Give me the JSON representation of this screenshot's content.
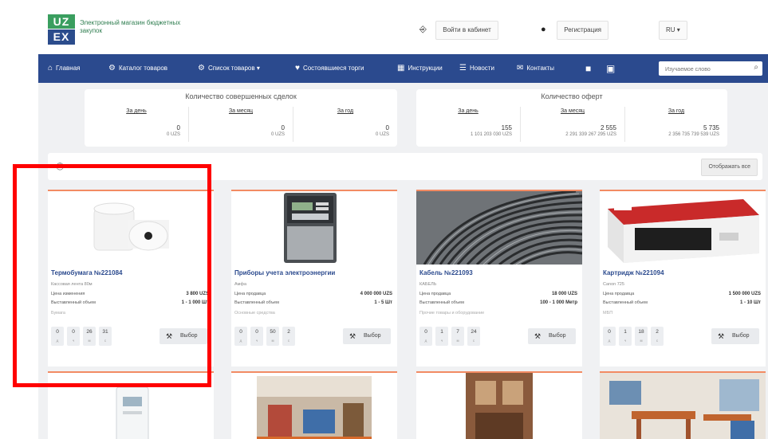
{
  "header": {
    "logo_top": "UZ",
    "logo_bottom": "EX",
    "logo_text": "Электронный магазин бюджетных закупок",
    "login_label": "Войти в кабинет",
    "register_label": "Регистрация",
    "lang_label": "RU"
  },
  "nav": {
    "items": [
      {
        "label": "Главная",
        "icon": "home-icon"
      },
      {
        "label": "Каталог товаров",
        "icon": "catalog-icon"
      },
      {
        "label": "Список товаров ▾",
        "icon": "list-icon"
      },
      {
        "label": "Состоявшиеся торги",
        "icon": "auction-icon"
      },
      {
        "label": "Инструкции",
        "icon": "instructions-icon"
      },
      {
        "label": "Новости",
        "icon": "news-icon"
      },
      {
        "label": "Контакты",
        "icon": "contacts-icon"
      }
    ],
    "search_placeholder": "Изучаемое слово"
  },
  "stats": {
    "deals": {
      "title": "Количество совершенных сделок",
      "cols": [
        {
          "label": "За день",
          "value": "0",
          "sub": "0 UZS"
        },
        {
          "label": "За месяц",
          "value": "0",
          "sub": "0 UZS"
        },
        {
          "label": "За год",
          "value": "0",
          "sub": "0 UZS"
        }
      ]
    },
    "offers": {
      "title": "Количество оферт",
      "cols": [
        {
          "label": "За день",
          "value": "155",
          "sub": "1 101 203 030 UZS"
        },
        {
          "label": "За месяц",
          "value": "2 555",
          "sub": "2 291 339 267 295 UZS"
        },
        {
          "label": "За год",
          "value": "5 735",
          "sub": "2 356 735 739 539 UZS"
        }
      ]
    }
  },
  "filter": {
    "button_label": "Отображать все"
  },
  "cards": [
    {
      "title": "Термобумага №221084",
      "category": "Кассовая лента 80м",
      "price_label": "Цена изменения",
      "price": "3 800 UZS",
      "volume_label": "Выставленный объем",
      "volume": "1 - 1 000 Шт",
      "subtitle": "Бумага",
      "timer": [
        {
          "n": "0",
          "u": "д"
        },
        {
          "n": "0",
          "u": "ч"
        },
        {
          "n": "26",
          "u": "м"
        },
        {
          "n": "31",
          "u": "с"
        }
      ],
      "button": "Выбор"
    },
    {
      "title": "Приборы учета электроэнергии",
      "category": "Амфа",
      "price_label": "Цена продавца",
      "price": "4 000 000 UZS",
      "volume_label": "Выставленный объем",
      "volume": "1 - 5 Шт",
      "subtitle": "Основные средства",
      "timer": [
        {
          "n": "0",
          "u": "д"
        },
        {
          "n": "0",
          "u": "ч"
        },
        {
          "n": "50",
          "u": "м"
        },
        {
          "n": "2",
          "u": "с"
        }
      ],
      "button": "Выбор"
    },
    {
      "title": "Кабель №221093",
      "category": "КАБЕЛЬ",
      "price_label": "Цена продавца",
      "price": "18 000 UZS",
      "volume_label": "Выставленный объем",
      "volume": "100 - 1 000 Метр",
      "subtitle": "Прочие товары и оборудование",
      "timer": [
        {
          "n": "0",
          "u": "д"
        },
        {
          "n": "1",
          "u": "ч"
        },
        {
          "n": "7",
          "u": "м"
        },
        {
          "n": "24",
          "u": "с"
        }
      ],
      "button": "Выбор"
    },
    {
      "title": "Картридж №221094",
      "category": "Canon 725",
      "price_label": "Цена продавца",
      "price": "1 500 000 UZS",
      "volume_label": "Выставленный объем",
      "volume": "1 - 10 Шт",
      "subtitle": "МБП",
      "timer": [
        {
          "n": "0",
          "u": "д"
        },
        {
          "n": "1",
          "u": "ч"
        },
        {
          "n": "18",
          "u": "м"
        },
        {
          "n": "2",
          "u": "с"
        }
      ],
      "button": "Выбор"
    }
  ]
}
